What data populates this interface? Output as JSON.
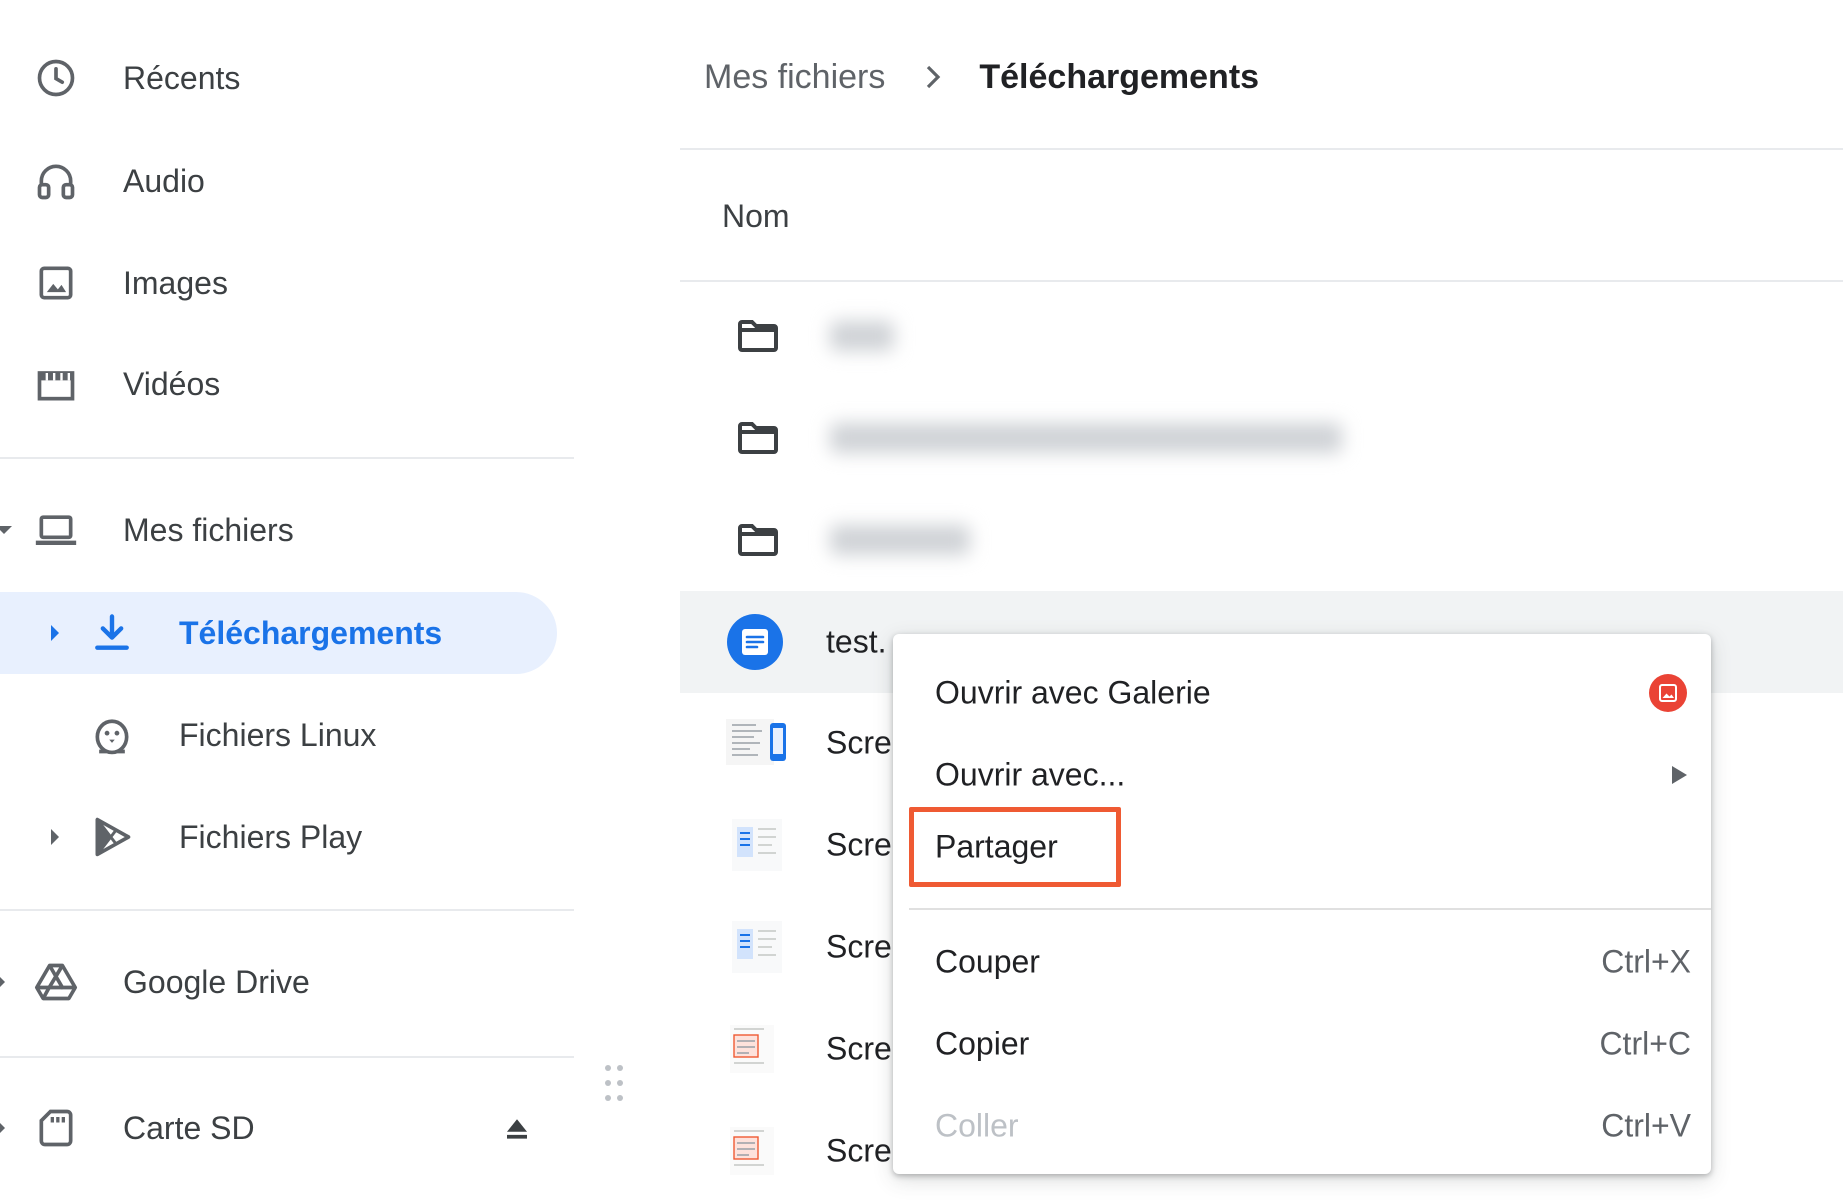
{
  "sidebar": {
    "items": [
      {
        "label": "Récents",
        "icon": "clock-icon"
      },
      {
        "label": "Audio",
        "icon": "headphones-icon"
      },
      {
        "label": "Images",
        "icon": "image-icon"
      },
      {
        "label": "Vidéos",
        "icon": "video-icon"
      },
      {
        "label": "Mes fichiers",
        "icon": "laptop-icon"
      },
      {
        "label": "Téléchargements",
        "icon": "download-icon",
        "selected": true
      },
      {
        "label": "Fichiers Linux",
        "icon": "linux-penguin-icon"
      },
      {
        "label": "Fichiers Play",
        "icon": "play-store-icon"
      },
      {
        "label": "Google Drive",
        "icon": "google-drive-icon"
      },
      {
        "label": "Carte SD",
        "icon": "sd-card-icon"
      }
    ]
  },
  "breadcrumb": {
    "items": [
      "Mes fichiers",
      "Téléchargements"
    ]
  },
  "file_list": {
    "column_name": "Nom",
    "rows": [
      {
        "type": "folder",
        "name": ""
      },
      {
        "type": "folder",
        "name": ""
      },
      {
        "type": "folder",
        "name": ""
      },
      {
        "type": "text-file",
        "name": "test."
      },
      {
        "type": "screenshot",
        "name": "Scre"
      },
      {
        "type": "screenshot",
        "name": "Scre"
      },
      {
        "type": "screenshot",
        "name": "Scre"
      },
      {
        "type": "screenshot",
        "name": "Scre"
      },
      {
        "type": "screenshot",
        "name": "Scre"
      }
    ]
  },
  "context_menu": {
    "items": [
      {
        "label": "Ouvrir avec Galerie",
        "icon": "gallery-app-icon"
      },
      {
        "label": "Ouvrir avec...",
        "submenu": true
      },
      {
        "label": "Partager",
        "highlighted": true
      },
      {
        "label": "Couper",
        "shortcut": "Ctrl+X"
      },
      {
        "label": "Copier",
        "shortcut": "Ctrl+C"
      },
      {
        "label": "Coller",
        "shortcut": "Ctrl+V",
        "disabled": true
      }
    ]
  },
  "colors": {
    "accent": "#1a73e8",
    "selected_bg": "#e8f0fe",
    "highlight_border": "#ef5a33",
    "gallery_badge": "#ea4335"
  }
}
